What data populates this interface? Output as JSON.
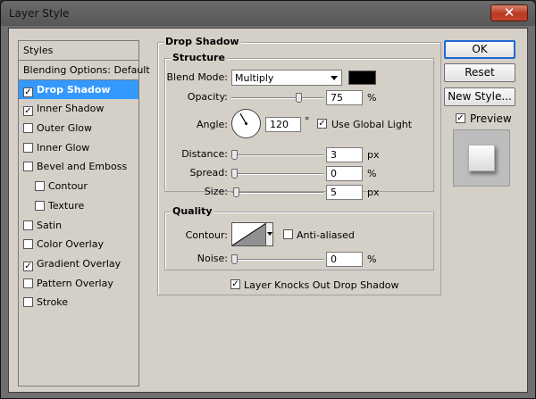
{
  "window": {
    "title": "Layer Style",
    "close_glyph": "✕"
  },
  "styles_panel": {
    "header": "Styles",
    "items": [
      {
        "label": "Blending Options: Default",
        "has_checkbox": false,
        "checked": false,
        "selected": false,
        "indent": false
      },
      {
        "label": "Drop Shadow",
        "has_checkbox": true,
        "checked": true,
        "selected": true,
        "indent": false
      },
      {
        "label": "Inner Shadow",
        "has_checkbox": true,
        "checked": true,
        "selected": false,
        "indent": false
      },
      {
        "label": "Outer Glow",
        "has_checkbox": true,
        "checked": false,
        "selected": false,
        "indent": false
      },
      {
        "label": "Inner Glow",
        "has_checkbox": true,
        "checked": false,
        "selected": false,
        "indent": false
      },
      {
        "label": "Bevel and Emboss",
        "has_checkbox": true,
        "checked": false,
        "selected": false,
        "indent": false
      },
      {
        "label": "Contour",
        "has_checkbox": true,
        "checked": false,
        "selected": false,
        "indent": true
      },
      {
        "label": "Texture",
        "has_checkbox": true,
        "checked": false,
        "selected": false,
        "indent": true
      },
      {
        "label": "Satin",
        "has_checkbox": true,
        "checked": false,
        "selected": false,
        "indent": false
      },
      {
        "label": "Color Overlay",
        "has_checkbox": true,
        "checked": false,
        "selected": false,
        "indent": false
      },
      {
        "label": "Gradient Overlay",
        "has_checkbox": true,
        "checked": true,
        "selected": false,
        "indent": false
      },
      {
        "label": "Pattern Overlay",
        "has_checkbox": true,
        "checked": false,
        "selected": false,
        "indent": false
      },
      {
        "label": "Stroke",
        "has_checkbox": true,
        "checked": false,
        "selected": false,
        "indent": false
      }
    ]
  },
  "drop_shadow": {
    "title": "Drop Shadow",
    "structure": {
      "title": "Structure",
      "blend_mode_label": "Blend Mode:",
      "blend_mode_value": "Multiply",
      "shadow_color": "#000000",
      "opacity_label": "Opacity:",
      "opacity_value": "75",
      "opacity_unit": "%",
      "opacity_fraction": 0.75,
      "angle_label": "Angle:",
      "angle_value": "120",
      "angle_unit": "°",
      "angle_degrees": 120,
      "use_global_light_label": "Use Global Light",
      "use_global_light_checked": true,
      "distance_label": "Distance:",
      "distance_value": "3",
      "distance_unit": "px",
      "distance_fraction": 0.0,
      "spread_label": "Spread:",
      "spread_value": "0",
      "spread_unit": "%",
      "spread_fraction": 0.0,
      "size_label": "Size:",
      "size_value": "5",
      "size_unit": "px",
      "size_fraction": 0.02
    },
    "quality": {
      "title": "Quality",
      "contour_label": "Contour:",
      "anti_aliased_label": "Anti-aliased",
      "anti_aliased_checked": false,
      "noise_label": "Noise:",
      "noise_value": "0",
      "noise_unit": "%",
      "noise_fraction": 0.0
    },
    "layer_knocks_out_label": "Layer Knocks Out Drop Shadow",
    "layer_knocks_out_checked": true
  },
  "buttons": {
    "ok": "OK",
    "reset": "Reset",
    "new_style": "New Style..."
  },
  "preview": {
    "label": "Preview",
    "checked": true
  }
}
